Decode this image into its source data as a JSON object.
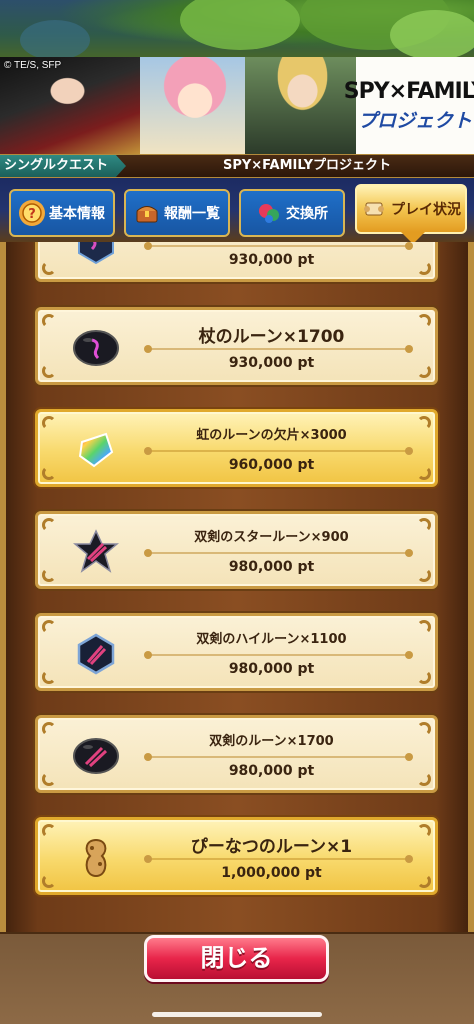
{
  "banner": {
    "copyright": "© TE/S, SFP",
    "logo_main": "SPY×FAMILY",
    "logo_sub": "プロジェクト"
  },
  "quest": {
    "type_label": "シングルクエスト",
    "name": "SPY×FAMILYプロジェクト"
  },
  "tabs": [
    {
      "label": "基本情報",
      "icon": "question-icon",
      "active": false
    },
    {
      "label": "報酬一覧",
      "icon": "treasure-chest-icon",
      "active": false
    },
    {
      "label": "交換所",
      "icon": "exchange-icon",
      "active": false
    },
    {
      "label": "プレイ状況",
      "icon": "scroll-icon",
      "active": true
    }
  ],
  "rewards": [
    {
      "name": "",
      "points": "930,000 pt",
      "style": "normal",
      "icon": "rune-icon"
    },
    {
      "name": "杖のルーン×1700",
      "points": "930,000 pt",
      "style": "normal",
      "icon": "staff-rune-icon"
    },
    {
      "name": "虹のルーンの欠片×3000",
      "points": "960,000 pt",
      "style": "gold",
      "icon": "rainbow-rune-fragment-icon"
    },
    {
      "name": "双剣のスタールーン×900",
      "points": "980,000 pt",
      "style": "normal",
      "icon": "twin-sword-star-rune-icon"
    },
    {
      "name": "双剣のハイルーン×1100",
      "points": "980,000 pt",
      "style": "normal",
      "icon": "twin-sword-high-rune-icon"
    },
    {
      "name": "双剣のルーン×1700",
      "points": "980,000 pt",
      "style": "normal",
      "icon": "twin-sword-rune-icon"
    },
    {
      "name": "ぴーなつのルーン×1",
      "points": "1,000,000 pt",
      "style": "gold",
      "icon": "peanut-rune-icon"
    }
  ],
  "close_button": {
    "label": "閉じる"
  },
  "colors": {
    "tab_blue": "#1f6fc8",
    "tab_active": "#f3c550",
    "card_normal": "#f4e3b8",
    "card_gold": "#f8d96c",
    "close_red": "#e8254a"
  }
}
